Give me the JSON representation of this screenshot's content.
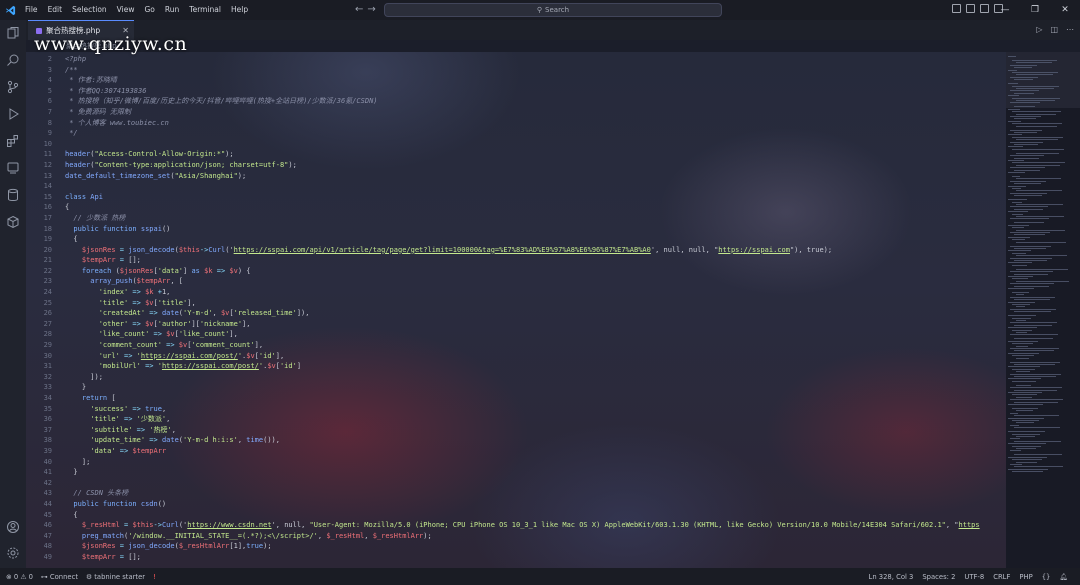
{
  "menu": [
    "File",
    "Edit",
    "Selection",
    "View",
    "Go",
    "Run",
    "Terminal",
    "Help"
  ],
  "search": {
    "label": "Search"
  },
  "tab": {
    "label": "聚合热搜榜.php"
  },
  "breadcrumb": "聚合热搜榜.php",
  "watermark": "www.qnziyw.cn",
  "code": [
    {
      "n": "2",
      "segs": [
        [
          "cmt",
          "<?php"
        ]
      ]
    },
    {
      "n": "3",
      "segs": [
        [
          "cmt",
          "/**"
        ]
      ]
    },
    {
      "n": "4",
      "segs": [
        [
          "cmt",
          " * 作者:苏晓晴"
        ]
      ]
    },
    {
      "n": "5",
      "segs": [
        [
          "cmt",
          " * 作者QQ:3074193836"
        ]
      ]
    },
    {
      "n": "6",
      "segs": [
        [
          "cmt",
          " * 热搜榜（知乎/微博/百度/历史上的今天/抖音/哔哩哔哩(热搜+全站日榜)/少数派/36氪/CSDN)"
        ]
      ]
    },
    {
      "n": "7",
      "segs": [
        [
          "cmt",
          " * 免费源码 无限制"
        ]
      ]
    },
    {
      "n": "8",
      "segs": [
        [
          "cmt",
          " * 个人博客 www.toubiec.cn"
        ]
      ]
    },
    {
      "n": "9",
      "segs": [
        [
          "cmt",
          " */"
        ]
      ]
    },
    {
      "n": "10",
      "segs": []
    },
    {
      "n": "11",
      "segs": [
        [
          "fn",
          "header"
        ],
        [
          "def",
          "("
        ],
        [
          "str",
          "\"Access-Control-Allow-Origin:*\""
        ],
        [
          "def",
          ");"
        ]
      ]
    },
    {
      "n": "12",
      "segs": [
        [
          "fn",
          "header"
        ],
        [
          "def",
          "("
        ],
        [
          "str",
          "\"Content-type:application/json; charset=utf-8\""
        ],
        [
          "def",
          ");"
        ]
      ]
    },
    {
      "n": "13",
      "segs": [
        [
          "fn",
          "date_default_timezone_set"
        ],
        [
          "def",
          "("
        ],
        [
          "str",
          "\"Asia/Shanghai\""
        ],
        [
          "def",
          ");"
        ]
      ]
    },
    {
      "n": "14",
      "segs": []
    },
    {
      "n": "15",
      "segs": [
        [
          "kw",
          "class"
        ],
        [
          "def",
          " "
        ],
        [
          "fn",
          "Api"
        ]
      ]
    },
    {
      "n": "16",
      "segs": [
        [
          "def",
          "{"
        ]
      ]
    },
    {
      "n": "17",
      "segs": [
        [
          "cmt",
          "  // 少数派 热榜"
        ]
      ]
    },
    {
      "n": "18",
      "segs": [
        [
          "kw",
          "  public function "
        ],
        [
          "fn",
          "sspai"
        ],
        [
          "def",
          "()"
        ]
      ]
    },
    {
      "n": "19",
      "segs": [
        [
          "def",
          "  {"
        ]
      ]
    },
    {
      "n": "20",
      "segs": [
        [
          "var",
          "    $jsonRes"
        ],
        [
          "op",
          " = "
        ],
        [
          "fn",
          "json_decode"
        ],
        [
          "def",
          "("
        ],
        [
          "var",
          "$this"
        ],
        [
          "op",
          "->"
        ],
        [
          "fn",
          "Curl"
        ],
        [
          "def",
          "('"
        ],
        [
          "url",
          "https://sspai.com/api/v1/article/tag/page/get?limit=100000&tag=%E7%83%AD%E9%97%A8%E6%96%87%E7%AB%A0"
        ],
        [
          "def",
          "', null, null, \""
        ],
        [
          "url",
          "https://sspai.com"
        ],
        [
          "def",
          "\"), true);"
        ]
      ]
    },
    {
      "n": "21",
      "segs": [
        [
          "var",
          "    $tempArr"
        ],
        [
          "op",
          " = "
        ],
        [
          "def",
          "[];"
        ]
      ]
    },
    {
      "n": "22",
      "segs": [
        [
          "kw",
          "    foreach "
        ],
        [
          "def",
          "("
        ],
        [
          "var",
          "$jsonRes"
        ],
        [
          "def",
          "["
        ],
        [
          "str",
          "'data'"
        ],
        [
          "def",
          "] "
        ],
        [
          "kw",
          "as "
        ],
        [
          "var",
          "$k"
        ],
        [
          "op",
          " => "
        ],
        [
          "var",
          "$v"
        ],
        [
          "def",
          ") {"
        ]
      ]
    },
    {
      "n": "23",
      "segs": [
        [
          "fn",
          "      array_push"
        ],
        [
          "def",
          "("
        ],
        [
          "var",
          "$tempArr"
        ],
        [
          "def",
          ", ["
        ]
      ]
    },
    {
      "n": "24",
      "segs": [
        [
          "str",
          "        'index'"
        ],
        [
          "op",
          " => "
        ],
        [
          "var",
          "$k"
        ],
        [
          "op",
          " +"
        ],
        [
          "def",
          "1,"
        ]
      ]
    },
    {
      "n": "25",
      "segs": [
        [
          "str",
          "        'title'"
        ],
        [
          "op",
          " => "
        ],
        [
          "var",
          "$v"
        ],
        [
          "def",
          "["
        ],
        [
          "str",
          "'title'"
        ],
        [
          "def",
          "],"
        ]
      ]
    },
    {
      "n": "26",
      "segs": [
        [
          "str",
          "        'createdAt'"
        ],
        [
          "op",
          " => "
        ],
        [
          "fn",
          "date"
        ],
        [
          "def",
          "("
        ],
        [
          "str",
          "'Y-m-d'"
        ],
        [
          "def",
          ", "
        ],
        [
          "var",
          "$v"
        ],
        [
          "def",
          "["
        ],
        [
          "str",
          "'released_time'"
        ],
        [
          "def",
          "]),"
        ]
      ]
    },
    {
      "n": "27",
      "segs": [
        [
          "str",
          "        'other'"
        ],
        [
          "op",
          " => "
        ],
        [
          "var",
          "$v"
        ],
        [
          "def",
          "["
        ],
        [
          "str",
          "'author'"
        ],
        [
          "def",
          "]["
        ],
        [
          "str",
          "'nickname'"
        ],
        [
          "def",
          "],"
        ]
      ]
    },
    {
      "n": "28",
      "segs": [
        [
          "str",
          "        'like_count'"
        ],
        [
          "op",
          " => "
        ],
        [
          "var",
          "$v"
        ],
        [
          "def",
          "["
        ],
        [
          "str",
          "'like_count'"
        ],
        [
          "def",
          "],"
        ]
      ]
    },
    {
      "n": "29",
      "segs": [
        [
          "str",
          "        'comment_count'"
        ],
        [
          "op",
          " => "
        ],
        [
          "var",
          "$v"
        ],
        [
          "def",
          "["
        ],
        [
          "str",
          "'comment_count'"
        ],
        [
          "def",
          "],"
        ]
      ]
    },
    {
      "n": "30",
      "segs": [
        [
          "str",
          "        'url'"
        ],
        [
          "op",
          " => "
        ],
        [
          "str",
          "'"
        ],
        [
          "url",
          "https://sspai.com/post/"
        ],
        [
          "str",
          "'"
        ],
        [
          "def",
          "."
        ],
        [
          "var",
          "$v"
        ],
        [
          "def",
          "["
        ],
        [
          "str",
          "'id'"
        ],
        [
          "def",
          "],"
        ]
      ]
    },
    {
      "n": "31",
      "segs": [
        [
          "str",
          "        'mobilUrl'"
        ],
        [
          "op",
          " => "
        ],
        [
          "str",
          "'"
        ],
        [
          "url",
          "https://sspai.com/post/"
        ],
        [
          "str",
          "'"
        ],
        [
          "def",
          "."
        ],
        [
          "var",
          "$v"
        ],
        [
          "def",
          "["
        ],
        [
          "str",
          "'id'"
        ],
        [
          "def",
          "]"
        ]
      ]
    },
    {
      "n": "32",
      "segs": [
        [
          "def",
          "      ]);"
        ]
      ]
    },
    {
      "n": "33",
      "segs": [
        [
          "def",
          "    }"
        ]
      ]
    },
    {
      "n": "34",
      "segs": [
        [
          "kw",
          "    return "
        ],
        [
          "def",
          "["
        ]
      ]
    },
    {
      "n": "35",
      "segs": [
        [
          "str",
          "      'success'"
        ],
        [
          "op",
          " => "
        ],
        [
          "kw",
          "true"
        ],
        [
          "def",
          ","
        ]
      ]
    },
    {
      "n": "36",
      "segs": [
        [
          "str",
          "      'title'"
        ],
        [
          "op",
          " => "
        ],
        [
          "str",
          "'少数派'"
        ],
        [
          "def",
          ","
        ]
      ]
    },
    {
      "n": "37",
      "segs": [
        [
          "str",
          "      'subtitle'"
        ],
        [
          "op",
          " => "
        ],
        [
          "str",
          "'热榜'"
        ],
        [
          "def",
          ","
        ]
      ]
    },
    {
      "n": "38",
      "segs": [
        [
          "str",
          "      'update_time'"
        ],
        [
          "op",
          " => "
        ],
        [
          "fn",
          "date"
        ],
        [
          "def",
          "("
        ],
        [
          "str",
          "'Y-m-d h:i:s'"
        ],
        [
          "def",
          ", "
        ],
        [
          "fn",
          "time"
        ],
        [
          "def",
          "()),"
        ]
      ]
    },
    {
      "n": "39",
      "segs": [
        [
          "str",
          "      'data'"
        ],
        [
          "op",
          " => "
        ],
        [
          "var",
          "$tempArr"
        ]
      ]
    },
    {
      "n": "40",
      "segs": [
        [
          "def",
          "    ];"
        ]
      ]
    },
    {
      "n": "41",
      "segs": [
        [
          "def",
          "  }"
        ]
      ]
    },
    {
      "n": "42",
      "segs": []
    },
    {
      "n": "43",
      "segs": [
        [
          "cmt",
          "  // CSDN 头条榜"
        ]
      ]
    },
    {
      "n": "44",
      "segs": [
        [
          "kw",
          "  public function "
        ],
        [
          "fn",
          "csdn"
        ],
        [
          "def",
          "()"
        ]
      ]
    },
    {
      "n": "45",
      "segs": [
        [
          "def",
          "  {"
        ]
      ]
    },
    {
      "n": "46",
      "segs": [
        [
          "var",
          "    $_resHtml"
        ],
        [
          "op",
          " = "
        ],
        [
          "var",
          "$this"
        ],
        [
          "op",
          "->"
        ],
        [
          "fn",
          "Curl"
        ],
        [
          "def",
          "('"
        ],
        [
          "url",
          "https://www.csdn.net"
        ],
        [
          "def",
          "', null, "
        ],
        [
          "str",
          "\"User-Agent: Mozilla/5.0 (iPhone; CPU iPhone OS 10_3_1 like Mac OS X) AppleWebKit/603.1.30 (KHTML, like Gecko) Version/10.0 Mobile/14E304 Safari/602.1\""
        ],
        [
          "def",
          ", \""
        ],
        [
          "url",
          "https"
        ]
      ]
    },
    {
      "n": "47",
      "segs": [
        [
          "fn",
          "    preg_match"
        ],
        [
          "def",
          "("
        ],
        [
          "str",
          "'/window.__INITIAL_STATE__=(.*?);<\\/script>/'"
        ],
        [
          "def",
          ", "
        ],
        [
          "var",
          "$_resHtml"
        ],
        [
          "def",
          ", "
        ],
        [
          "var",
          "$_resHtmlArr"
        ],
        [
          "def",
          ");"
        ]
      ]
    },
    {
      "n": "48",
      "segs": [
        [
          "var",
          "    $jsonRes"
        ],
        [
          "op",
          " = "
        ],
        [
          "fn",
          "json_decode"
        ],
        [
          "def",
          "("
        ],
        [
          "var",
          "$_resHtmlArr"
        ],
        [
          "def",
          "[1],"
        ],
        [
          "kw",
          "true"
        ],
        [
          "def",
          ");"
        ]
      ]
    },
    {
      "n": "49",
      "segs": [
        [
          "var",
          "    $tempArr"
        ],
        [
          "op",
          " = "
        ],
        [
          "def",
          "[];"
        ]
      ]
    }
  ],
  "status": {
    "problems": "⊗ 0 ⚠ 0",
    "connect": "Connect",
    "tabnine": "tabnine starter",
    "alert": "!",
    "position": "Ln 328, Col 3",
    "spaces": "Spaces: 2",
    "encoding": "UTF-8",
    "eol": "CRLF",
    "language": "PHP"
  }
}
